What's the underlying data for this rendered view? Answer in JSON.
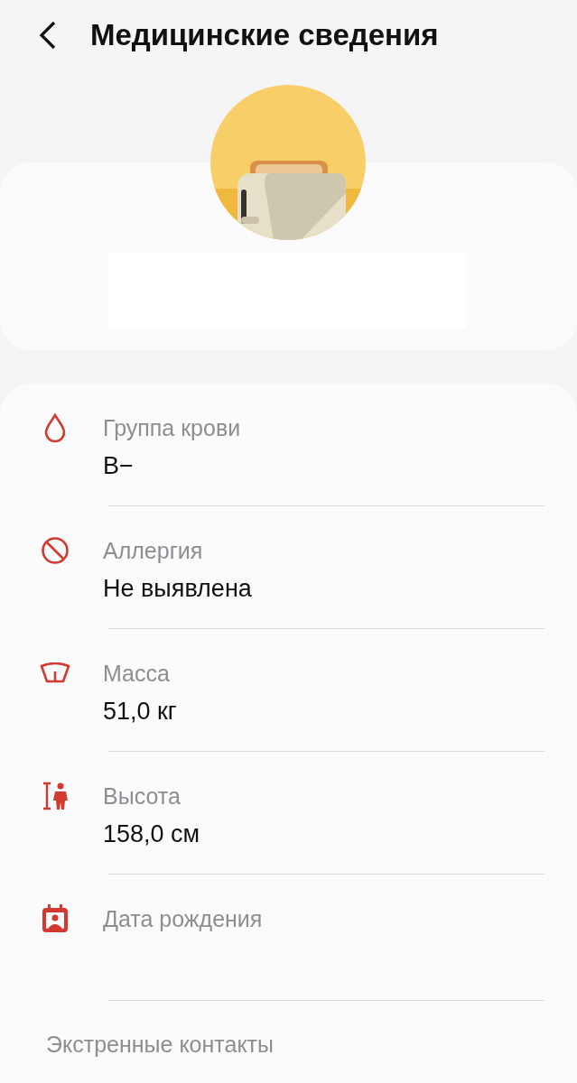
{
  "header": {
    "title": "Медицинские сведения"
  },
  "medical_info": [
    {
      "kind": "blood",
      "label": "Группа крови",
      "value": "B−"
    },
    {
      "kind": "allergy",
      "label": "Аллергия",
      "value": "Не выявлена"
    },
    {
      "kind": "weight",
      "label": "Масса",
      "value": "51,0 кг"
    },
    {
      "kind": "height",
      "label": "Высота",
      "value": "158,0 см"
    },
    {
      "kind": "birthdate",
      "label": "Дата рождения"
    }
  ],
  "emergency_contacts": {
    "title": "Экстренные контакты"
  }
}
